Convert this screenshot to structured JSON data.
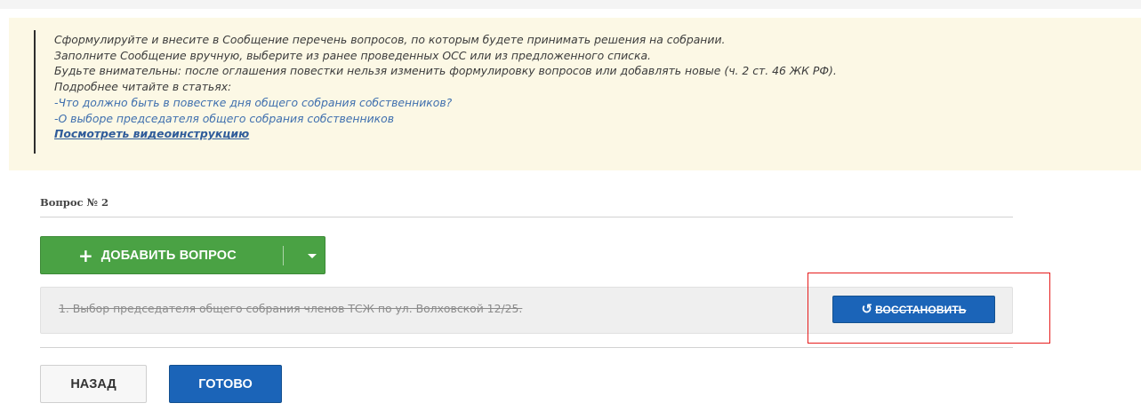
{
  "info": {
    "lines": [
      "Сформулируйте и внесите в Сообщение перечень вопросов, по которым будете принимать решения на собрании.",
      "Заполните Сообщение вручную, выберите из ранее проведенных ОСС или из предложенного списка.",
      "Будьте внимательны: после оглашения повестки нельзя изменить формулировку вопросов или добавлять новые (ч. 2 ст. 46 ЖК РФ).",
      "Подробнее читайте в статьях:"
    ],
    "links": [
      "-Что должно быть в повестке дня общего собрания собственников?",
      "-О выборе председателя общего собрания собственников"
    ],
    "video_link": "Посмотреть видеоинструкцию"
  },
  "question_label": "Вопрос № 2",
  "add_button": {
    "icon": "plus-icon",
    "label": "ДОБАВИТЬ ВОПРОС",
    "dropdown_icon": "caret-down-icon"
  },
  "question_item": {
    "text": "1. Выбор председателя общего собрания членов ТСЖ по ул. Волховской 12/25."
  },
  "restore_button": {
    "icon": "undo-icon",
    "label": "ВОССТАНОВИТЬ"
  },
  "footer": {
    "back_label": "НАЗАД",
    "done_label": "ГОТОВО"
  },
  "colors": {
    "info_bg": "#fcf8e5",
    "green": "#4aa244",
    "blue": "#1b64b8",
    "highlight": "#e61c1c",
    "link": "#3f6fae"
  }
}
